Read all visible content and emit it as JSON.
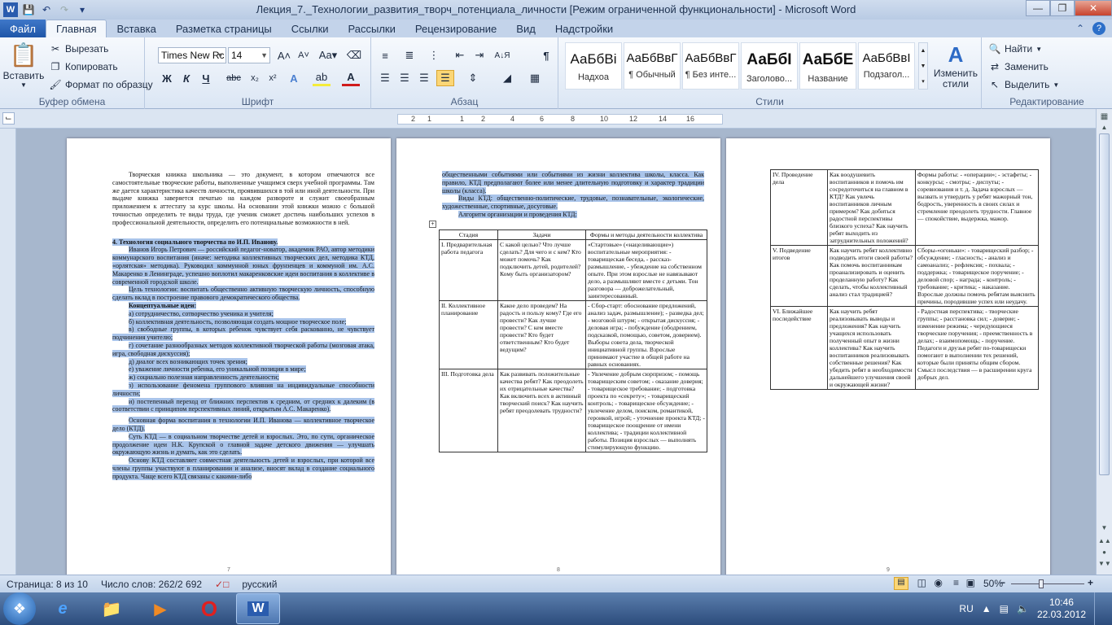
{
  "window": {
    "title": "Лекция_7._Технологии_развития_творч_потенциала_личности [Режим ограниченной функциональности]  -  Microsoft Word"
  },
  "tabs": [
    "Файл",
    "Главная",
    "Вставка",
    "Разметка страницы",
    "Ссылки",
    "Рассылки",
    "Рецензирование",
    "Вид",
    "Надстройки"
  ],
  "active_tab": "Главная",
  "ribbon": {
    "clipboard": {
      "paste": "Вставить",
      "cut": "Вырезать",
      "copy": "Копировать",
      "format_painter": "Формат по образцу",
      "label": "Буфер обмена"
    },
    "font": {
      "name": "Times New Rc",
      "size": "14",
      "label": "Шрифт"
    },
    "paragraph": {
      "label": "Абзац"
    },
    "styles": {
      "label": "Стили",
      "items": [
        {
          "sample": "АаБбВі",
          "name": "Надхоа"
        },
        {
          "sample": "АаБбВвГ",
          "name": "¶ Обычный"
        },
        {
          "sample": "АаБбВвГ",
          "name": "¶ Без инте..."
        },
        {
          "sample": "АаБбІ",
          "name": "Заголово..."
        },
        {
          "sample": "АаБбЕ",
          "name": "Название"
        },
        {
          "sample": "АаБбВвІ",
          "name": "Подзагол..."
        }
      ],
      "change": "Изменить стили"
    },
    "editing": {
      "find": "Найти",
      "replace": "Заменить",
      "select": "Выделить",
      "label": "Редактирование"
    }
  },
  "ruler": {
    "ticks": [
      "2",
      "1",
      "1",
      "2",
      "4",
      "6",
      "8",
      "10",
      "12",
      "14",
      "16"
    ]
  },
  "pages": {
    "page7": {
      "num": "7",
      "p1": "Творческая книжка школьника — это документ, в котором отмечаются все самостоятельные творческие работы, выполненные учащимся сверх учебной программы. Там же дается характеристика качеств личности, проявившихся в той или иной деятельности. При выдаче книжка заверяется печатью на каждом развороте и служит своеобразным приложением к аттестату за курс школы. На основании этой книжки можно с большой точностью определить те виды труда, где ученик сможет достичь наибольших успехов в профессиональной деятельности, определить его потенциальные возможности в ней.",
      "h4": "4. Технология социального творчества по И.П. Иванову.",
      "p2": "Иванов Игорь Петрович — российский педагог-новатор, академик РАО, автор методики коммунарского воспитания (иначе: методика коллективных творческих дел, методика КТД, «орлятская» методика). Руководил коммунной юных фрунзенцев и коммуной им. А.С. Макаренко в Ленинграде, успешно воплотил макаренковские идеи воспитания в коллективе в современной городской школе.",
      "p3": "Цель технологии: воспитать общественно активную творческую личность, способную сделать вклад в построение правового демократического общества.",
      "p4": "Концептуальные идеи:",
      "l1": "а) сотрудничество, сотворчество ученика и учителя;",
      "l2": "б) коллективная деятельность, позволяющая создать мощное творческое поле;",
      "l3": "в) свободные группы, в которых ребенок чувствует себя раскованно, не чувствует подчинения учителю;",
      "l4": "г) сочетание разнообразных методов коллективной творческой работы (мозговая атака, игра, свободная дискуссия);",
      "l5": "д) диалог всех возникающих точек зрения;",
      "l6": "е) уважение личности ребенка, его уникальной позиции в мире;",
      "l7": "ж) социально полезная направленность деятельности;",
      "l8": "з) использование феномена группового влияния на индивидуальные способности личности;",
      "l9": "и) постепенный переход от ближних перспектив к средним, от средних к далеким (в соответствии с принципом перспективных линий, открытым А.С. Макаренко).",
      "p5": "Основная форма воспитания в технологии И.П. Иванова — коллективное творческое дело (КТД).",
      "p6": "Суть КТД — в социальном творчестве детей и взрослых. Это, по сути, органическое продолжение идеи Н.К. Крупской о главной задаче детского движения — улучшать окружающую жизнь и думать, как это сделать.",
      "p7": "Основу КТД составляет совместная деятельность детей и взрослых, при которой все члены группы участвуют в планировании и анализе, вносят вклад в создание социального продукта. Чаще всего КТД связаны с какими-либо"
    },
    "page8": {
      "num": "8",
      "p1": "общественными событиями или событиями из жизни коллектива школы, класса. Как правило, КТД предполагают более или менее длительную подготовку и характер традиции школы (класса).",
      "p2": "Виды КТД: общественно-политические, трудовые, познавательные, экологические, художественные, спортивные, досуговые.",
      "p3": "Алгоритм организации и проведения КТД:",
      "headers": [
        "Стадия",
        "Задачи",
        "Формы и методы деятельности коллектива"
      ],
      "rows": [
        [
          "I. Предварительная работа педагога",
          "С какой целью? Что лучше сделать? Для чего и с кем? Кто может помочь? Как подключить детей, родителей? Кому быть организатором?",
          "«Стартовые» («нацеливающие») воспитательные мероприятия: - товарищеская беседа, - рассказ-размышление, - убеждение на собственном опыте. При этом взрослые не навязывают дело, а размышляют вместе с детьми. Тон разговора — доброжелательный, заинтересованный."
        ],
        [
          "II. Коллективное планирование",
          "Какое дело проведем? На радость и пользу кому? Где его провести? Как лучше провести? С кем вместе провести? Кто будет ответственным? Кто будет ведущим?",
          "- Сбор-старт: обоснование предложений, анализ задач, размышление); - разведка дел; - мозговой штурм; - открытая дискуссия; - деловая игра; - побуждение (ободрением, подсказкой, помощью, советом, доверием). Выборы совета дела, творческой инициативной группы. Взрослые принимают участие в общей работе на равных основаниях."
        ],
        [
          "III. Подготовка дела",
          "Как развивать положительные качества ребят? Как преодолеть их отрицательные качества? Как включить всех в активный творческий поиск? Как научить ребят преодолевать трудности?",
          "- Увлечение добрым сюрпризом; - помощь товарищеским советом; - оказание доверия; - товарищеское требование; - подготовка проекта по «секрету»; - товарищеский контроль; - товарищеское обсуждение; - увлечение делом, поиском, романтикой, героикой, игрой; - уточнение проекта КТД; - товарищеское поощрение от имени коллектива; - традиции коллективной работы. Позиция взрослых — выполнять стимулирующую функцию."
        ]
      ]
    },
    "page9": {
      "num": "9",
      "rows": [
        [
          "IV. Проведение дела",
          "Как воодушевить воспитанников и помочь им сосредоточиться на главном в КТД? Как увлечь воспитанников личным примером? Как добиться радостной перспективы близкого успеха? Как научить ребят выходить из затруднительных положений?",
          "Формы работы: - «операции»; - эстафеты; - конкурсы; - смотры; - диспуты; - соревнования и т. д. Задача взрослых — вызвать и утвердить у ребят мажорный тон, бодрость, уверенность в своих силах и стремление преодолеть трудности. Главное — спокойствие, выдержка, мажор."
        ],
        [
          "V. Подведение итогов",
          "Как научить ребят коллективно подводить итоги своей работы? Как помочь воспитанникам проанализировать и оценить проделанную работу? Как сделать, чтобы коллективный анализ стал традицией?",
          "Сборы-«огоньки»: - товарищеский разбор; - обсуждение; - гласность; - анализ и самоанализ; - рефлексия; - похвала; - поддержка; - товарищеское поручение; - деловой спор; - награда; - контроль; - требование; - критика; - наказание. Взрослые должны помочь ребятам выяснить причины, породившие успех или неудачу."
        ],
        [
          "VI. Ближайшее последействие",
          "Как научить ребят реализовывать выводы и предложения? Как научить учащихся использовать полученный опыт в жизни коллектива? Как научить воспитанников реализовывать собственные решения? Как убедить ребят в необходимости дальнейшего улучшения своей и окружающей жизни?",
          "- Радостная перспектива; - творческие группы; - расстановка сил; - доверие; - изменение режима; - чередующиеся творческие поручения; - преемственность в делах; - взаимопомощь; - поручение. Педагоги и друзья ребят по-товарищески помогают в выполнении тех решений, которые были приняты общим сбором. Смысл последствия — в расширении круга добрых дел."
        ]
      ]
    }
  },
  "status": {
    "page": "Страница: 8 из 10",
    "words": "Число слов: 262/2 692",
    "lang": "русский",
    "zoom": "50%"
  },
  "taskbar": {
    "lang": "RU",
    "time": "10:46",
    "date": "22.03.2012"
  }
}
